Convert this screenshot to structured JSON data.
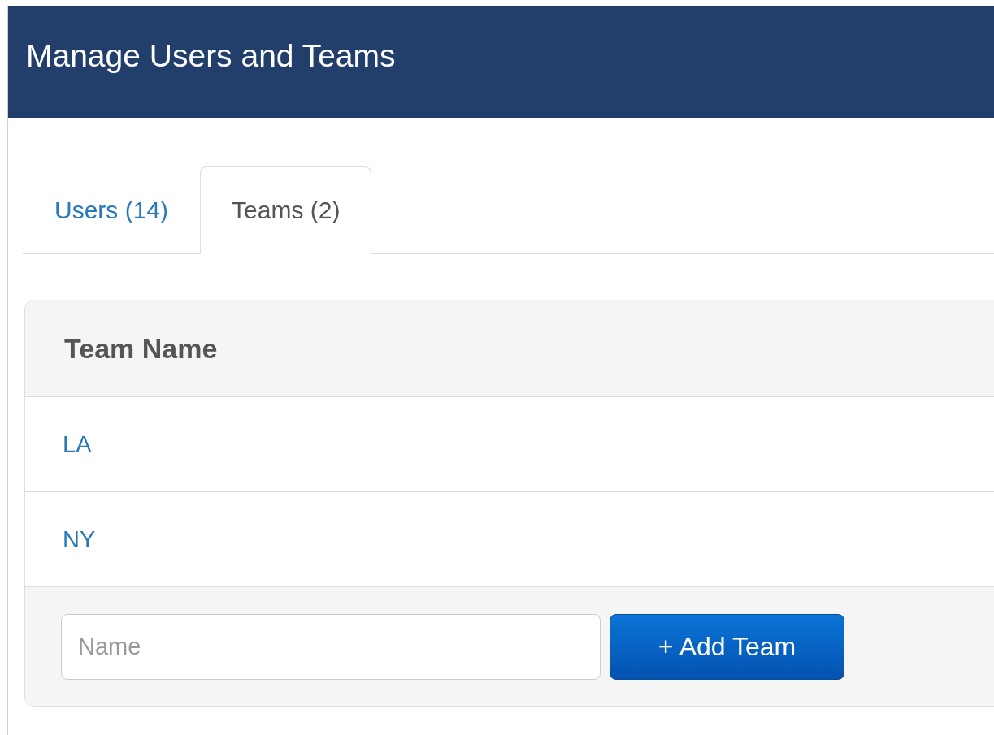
{
  "header": {
    "title": "Manage Users and Teams"
  },
  "tabs": [
    {
      "label": "Users (14)",
      "selected": false
    },
    {
      "label": "Teams (2)",
      "selected": true
    }
  ],
  "table": {
    "columns": [
      "Team Name"
    ],
    "rows": [
      {
        "name": "LA"
      },
      {
        "name": "NY"
      }
    ]
  },
  "new_team": {
    "placeholder": "Name",
    "button": "+ Add Team"
  }
}
